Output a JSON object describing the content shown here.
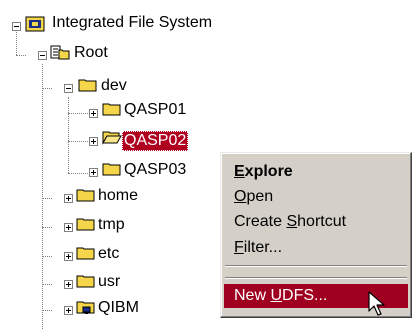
{
  "tree": {
    "root_system": "Integrated File System",
    "root": "Root",
    "dev": "dev",
    "dev_children": [
      "QASP01",
      "QASP02",
      "QASP03"
    ],
    "siblings": [
      "home",
      "tmp",
      "etc",
      "usr",
      "QIBM"
    ],
    "selected": "QASP02"
  },
  "context_menu": {
    "explore": {
      "pre": "",
      "key": "E",
      "post": "xplore"
    },
    "open": {
      "pre": "",
      "key": "O",
      "post": "pen"
    },
    "create_shortcut": {
      "pre": "Create ",
      "key": "S",
      "post": "hortcut"
    },
    "filter": {
      "pre": "",
      "key": "F",
      "post": "ilter..."
    },
    "new_udfs": {
      "pre": "New ",
      "key": "U",
      "post": "DFS..."
    }
  },
  "colors": {
    "selection": "#b00020",
    "menu_highlight": "#a00020",
    "menu_face": "#d4d0c8",
    "folder_yellow": "#f5d64a"
  }
}
